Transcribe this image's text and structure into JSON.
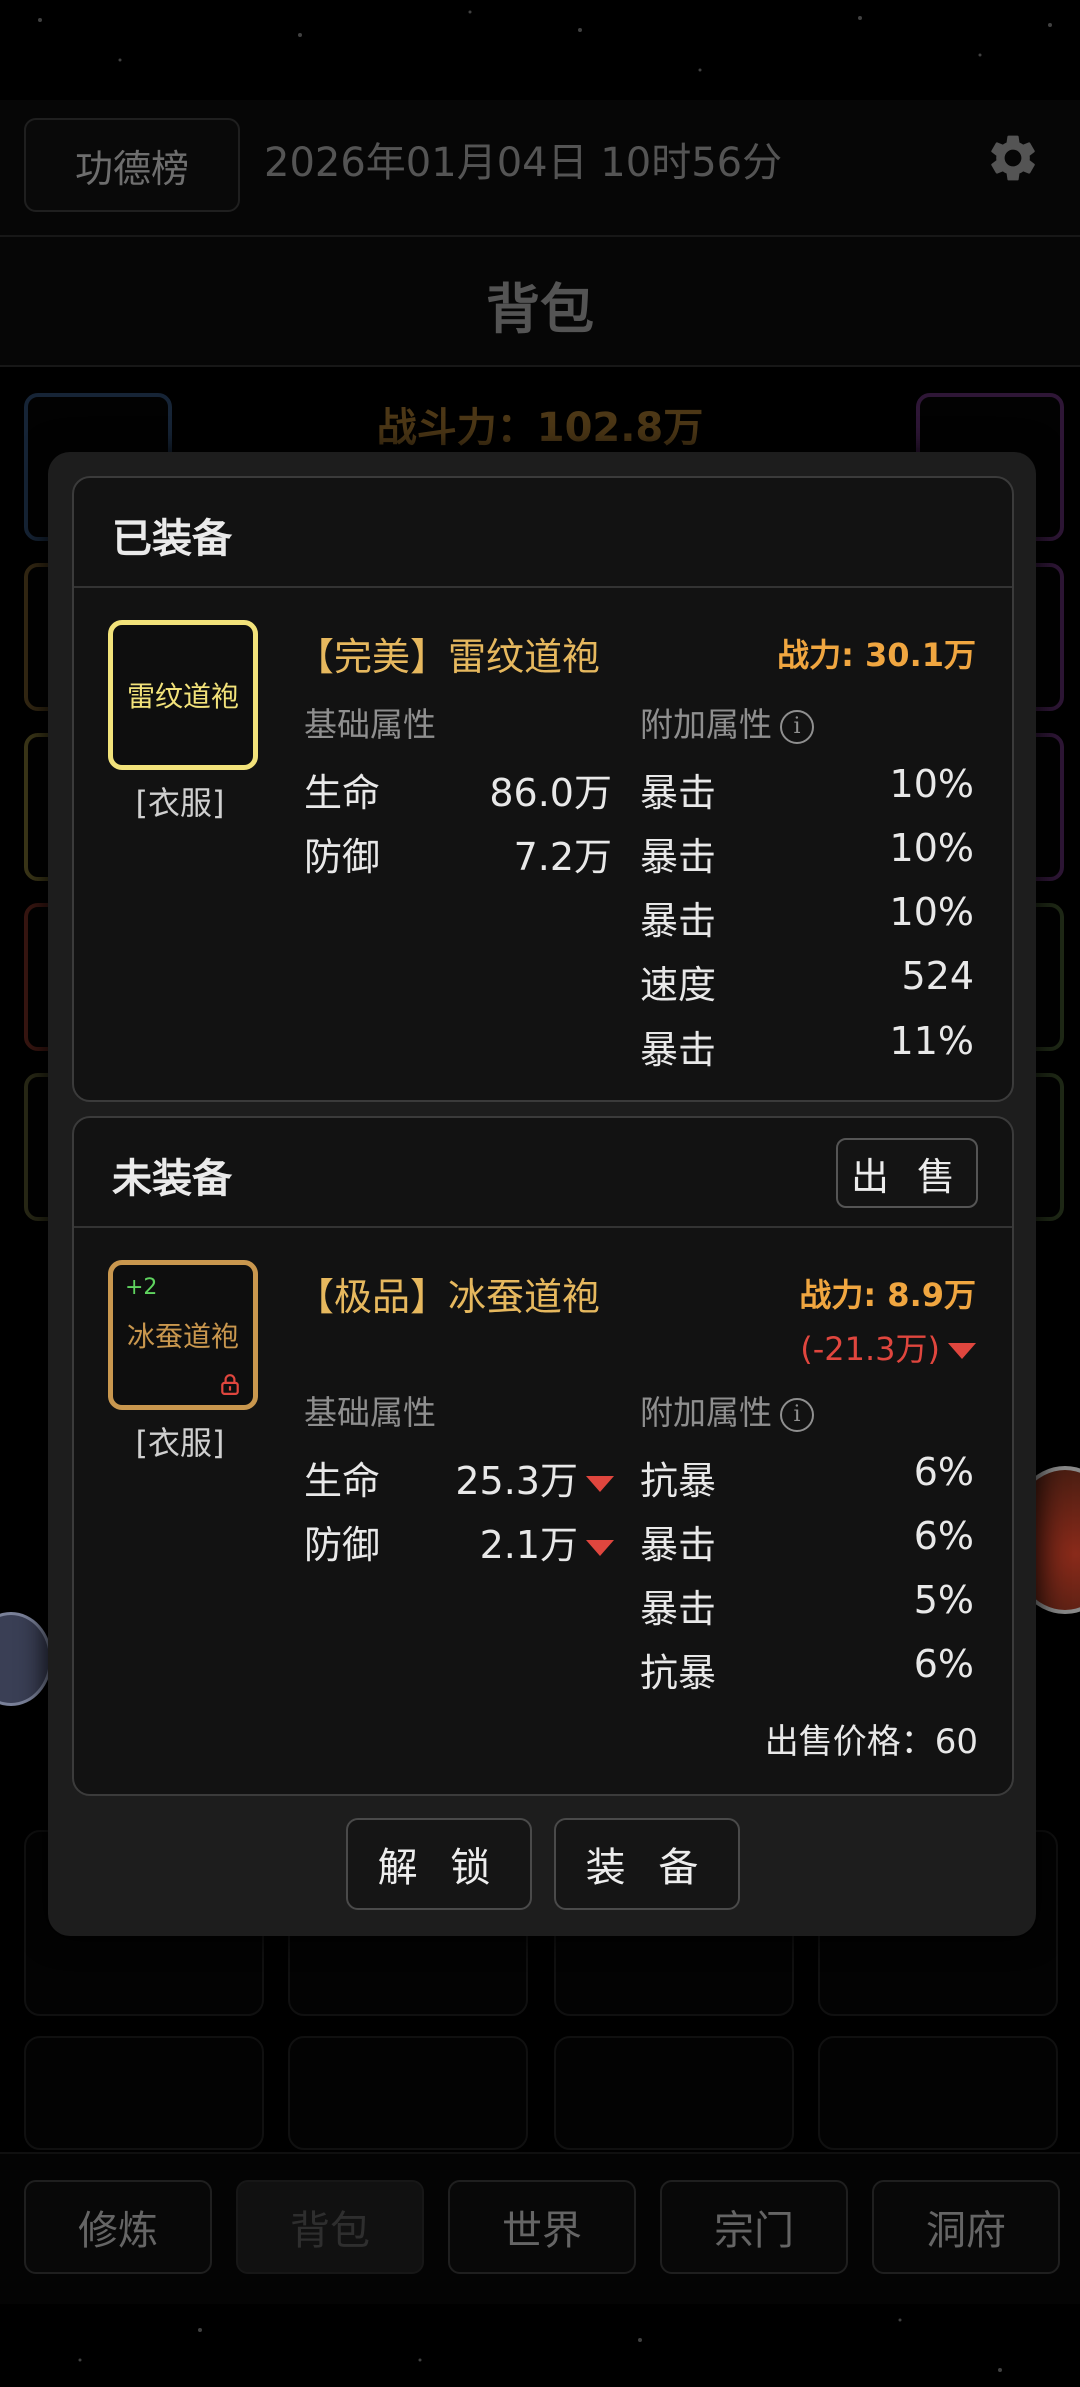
{
  "topbar": {
    "merit_button": "功德榜",
    "datetime": "2026年01月04日 10时56分"
  },
  "page": {
    "title": "背包",
    "combat_power": "战斗力：102.8万"
  },
  "equipped": {
    "heading": "已装备",
    "item": {
      "icon_label": "雷纹道袍",
      "type": "[衣服]",
      "name": "【完美】雷纹道袍",
      "power": "战力: 30.1万",
      "base_heading": "基础属性",
      "extra_heading": "附加属性",
      "base": [
        {
          "k": "生命",
          "v": "86.0万"
        },
        {
          "k": "防御",
          "v": "7.2万"
        }
      ],
      "extra": [
        {
          "k": "暴击",
          "v": "10%"
        },
        {
          "k": "暴击",
          "v": "10%"
        },
        {
          "k": "暴击",
          "v": "10%"
        },
        {
          "k": "速度",
          "v": "524"
        },
        {
          "k": "暴击",
          "v": "11%"
        }
      ]
    }
  },
  "unequipped": {
    "heading": "未装备",
    "sell_button": "出 售",
    "item": {
      "level": "+2",
      "icon_label": "冰蚕道袍",
      "type": "[衣服]",
      "name": "【极品】冰蚕道袍",
      "power": "战力: 8.9万",
      "power_diff": "(-21.3万)",
      "base_heading": "基础属性",
      "extra_heading": "附加属性",
      "base": [
        {
          "k": "生命",
          "v": "25.3万"
        },
        {
          "k": "防御",
          "v": "2.1万"
        }
      ],
      "extra": [
        {
          "k": "抗暴",
          "v": "6%"
        },
        {
          "k": "暴击",
          "v": "6%"
        },
        {
          "k": "暴击",
          "v": "5%"
        },
        {
          "k": "抗暴",
          "v": "6%"
        }
      ],
      "sell_price": "出售价格：60"
    }
  },
  "actions": {
    "unlock": "解 锁",
    "equip": "装 备"
  },
  "nav": [
    "修炼",
    "背包",
    "世界",
    "宗门",
    "洞府"
  ],
  "colors": {
    "perfect": "#f2e27a",
    "legendary": "#c9974e",
    "power": "#f0a640",
    "down": "#e0463e"
  },
  "icons": {
    "settings": "gear-icon",
    "lock": "lock-icon",
    "info": "info-icon",
    "down": "triangle-down-icon"
  }
}
